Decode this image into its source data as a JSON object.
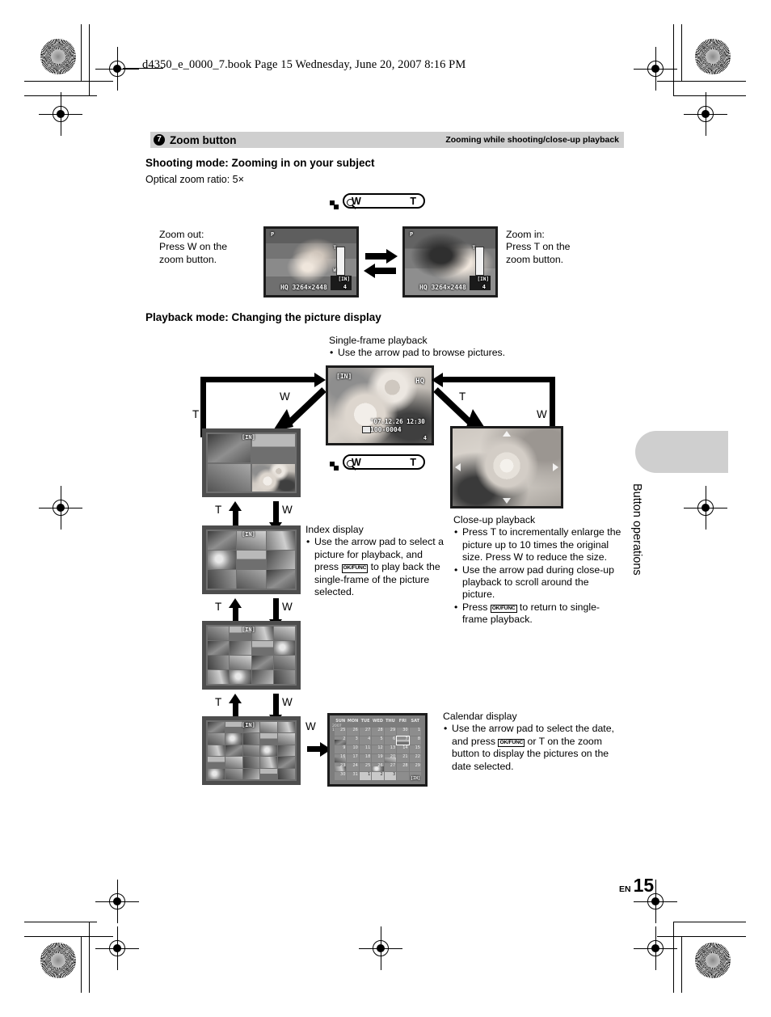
{
  "print_header": "d4350_e_0000_7.book  Page 15  Wednesday, June 20, 2007  8:16 PM",
  "section": {
    "number": "7",
    "title": "Zoom button",
    "subtitle": "Zooming while shooting/close-up playback"
  },
  "shooting": {
    "heading": "Shooting mode: Zooming in on your subject",
    "ratio": "Optical zoom ratio: 5×",
    "zoom_out": [
      "Zoom out:",
      "Press W on the",
      "zoom button."
    ],
    "zoom_in": [
      "Zoom in:",
      "Press T on the",
      "zoom button."
    ],
    "lcd_left": {
      "mode": "P",
      "info": "HQ 3264×2448",
      "battery": "[IN]",
      "count": "4"
    },
    "lcd_right": {
      "mode": "P",
      "info": "HQ 3264×2448",
      "battery": "[IN]",
      "count": "4"
    }
  },
  "playback": {
    "heading": "Playback mode: Changing the picture display",
    "single_frame": {
      "title": "Single-frame playback",
      "bullets": [
        "Use the arrow pad to browse pictures."
      ],
      "badge": "HQ",
      "battery": "[IN]",
      "date": "'07.12.26   12:30",
      "file": "100-0004",
      "count": "4"
    },
    "index": {
      "title": "Index display",
      "bullets": [
        "Use the arrow pad to select a picture for playback, and press OK/FUNC to play back the single-frame of the picture selected."
      ],
      "bullet_parts": {
        "pre": "Use the arrow pad to select a picture for playback, and press",
        "key": "OK/FUNC",
        "post": "to play back the single-frame of the picture selected."
      },
      "battery": "[IN]"
    },
    "closeup": {
      "title": "Close-up playback",
      "bullets": [
        "Press T to incrementally enlarge the picture up to 10 times the original size. Press W to reduce the size.",
        "Use the arrow pad during close-up playback to scroll around the picture."
      ],
      "bullet3": {
        "pre": "Press",
        "key": "OK/FUNC",
        "post": "to return to single-frame playback."
      }
    },
    "calendar": {
      "title": "Calendar display",
      "bullet": {
        "pre": "Use the arrow pad to select the date, and press",
        "key": "OK/FUNC",
        "post": "or T on the zoom button to display the pictures on the date selected."
      },
      "year": "2007",
      "month": "12",
      "weekdays": [
        "SUN",
        "MON",
        "TUE",
        "WED",
        "THU",
        "FRI",
        "SAT"
      ],
      "battery": "[IN]",
      "weeks": [
        [
          {
            "d": "25"
          },
          {
            "d": "26"
          },
          {
            "d": "27"
          },
          {
            "d": "28"
          },
          {
            "d": "29"
          },
          {
            "d": "30"
          },
          {
            "d": "1"
          }
        ],
        [
          {
            "d": "2",
            "p": 1
          },
          {
            "d": "3"
          },
          {
            "d": "4"
          },
          {
            "d": "5"
          },
          {
            "d": "6"
          },
          {
            "d": "7",
            "p": 1,
            "sel": 1
          },
          {
            "d": "8"
          }
        ],
        [
          {
            "d": "9"
          },
          {
            "d": "10"
          },
          {
            "d": "11"
          },
          {
            "d": "12"
          },
          {
            "d": "13"
          },
          {
            "d": "14"
          },
          {
            "d": "15"
          }
        ],
        [
          {
            "d": "16",
            "p": 1
          },
          {
            "d": "17"
          },
          {
            "d": "18"
          },
          {
            "d": "19"
          },
          {
            "d": "20",
            "p": 1
          },
          {
            "d": "21"
          },
          {
            "d": "22"
          }
        ],
        [
          {
            "d": "23",
            "p": 1
          },
          {
            "d": "24"
          },
          {
            "d": "25"
          },
          {
            "d": "26",
            "p": 1
          },
          {
            "d": "27"
          },
          {
            "d": "28"
          },
          {
            "d": "29"
          }
        ],
        [
          {
            "d": "30"
          },
          {
            "d": "31"
          },
          {
            "d": "1",
            "lit": 1
          },
          {
            "d": "2",
            "lit": 1
          },
          {
            "d": "3",
            "lit": 1
          },
          {
            "d": ""
          },
          {
            "d": ""
          }
        ]
      ]
    },
    "zoom_labels": {
      "w": "W",
      "t": "T"
    }
  },
  "rocker": {
    "w": "W",
    "t": "T"
  },
  "sidetab": {
    "label": "Button operations"
  },
  "footer": {
    "lang": "EN",
    "page": "15"
  }
}
